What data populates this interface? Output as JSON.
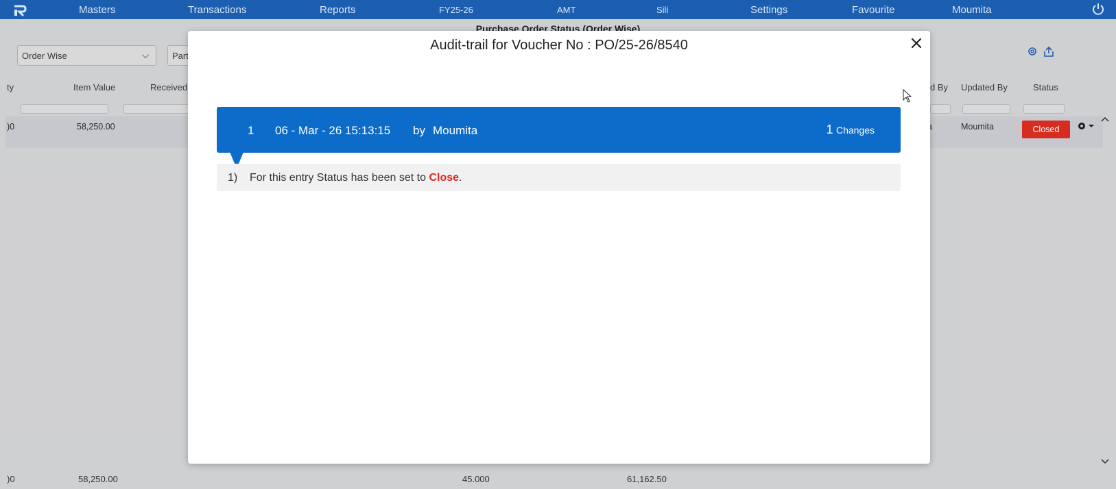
{
  "nav": {
    "items": [
      "Masters",
      "Transactions",
      "Reports",
      "FY25-26",
      "AMT",
      "Sili",
      "Settings",
      "Favourite",
      "Moumita"
    ]
  },
  "page": {
    "title": "Purchase Order Status (Order Wise)",
    "order_select": "Order Wise",
    "party_select": "Part",
    "columns": [
      "ty",
      "Item Value",
      "Received",
      "d By",
      "Updated By",
      "Status"
    ],
    "row": {
      "qty": ")0",
      "item_value": "58,250.00",
      "created_by_tail": "a",
      "updated_by": "Moumita",
      "status": "Closed"
    },
    "footer": {
      "qty": ")0",
      "item_value": "58,250.00",
      "received": "45.000",
      "total": "61,162.50"
    }
  },
  "modal": {
    "title": "Audit-trail for Voucher No : PO/25-26/8540",
    "entry": {
      "number": "1",
      "timestamp": "06 - Mar - 26 15:13:15",
      "by_label": "by",
      "user": "Moumita",
      "changes_count": "1",
      "changes_label": "Changes"
    },
    "changes": [
      {
        "index": "1)",
        "prefix": "For this entry Status has been set to ",
        "value": "Close",
        "suffix": "."
      }
    ]
  },
  "colors": {
    "nav_bg": "#1c5fb0",
    "entry_bar": "#0d6bc9",
    "status_closed": "#d62d20",
    "highlight": "#e0261b"
  },
  "icons": [
    "app-logo-icon",
    "power-icon",
    "settings-gear-icon",
    "export-icon",
    "close-icon",
    "row-gear-icon",
    "scroll-up-icon",
    "scroll-down-icon",
    "cursor-icon"
  ]
}
